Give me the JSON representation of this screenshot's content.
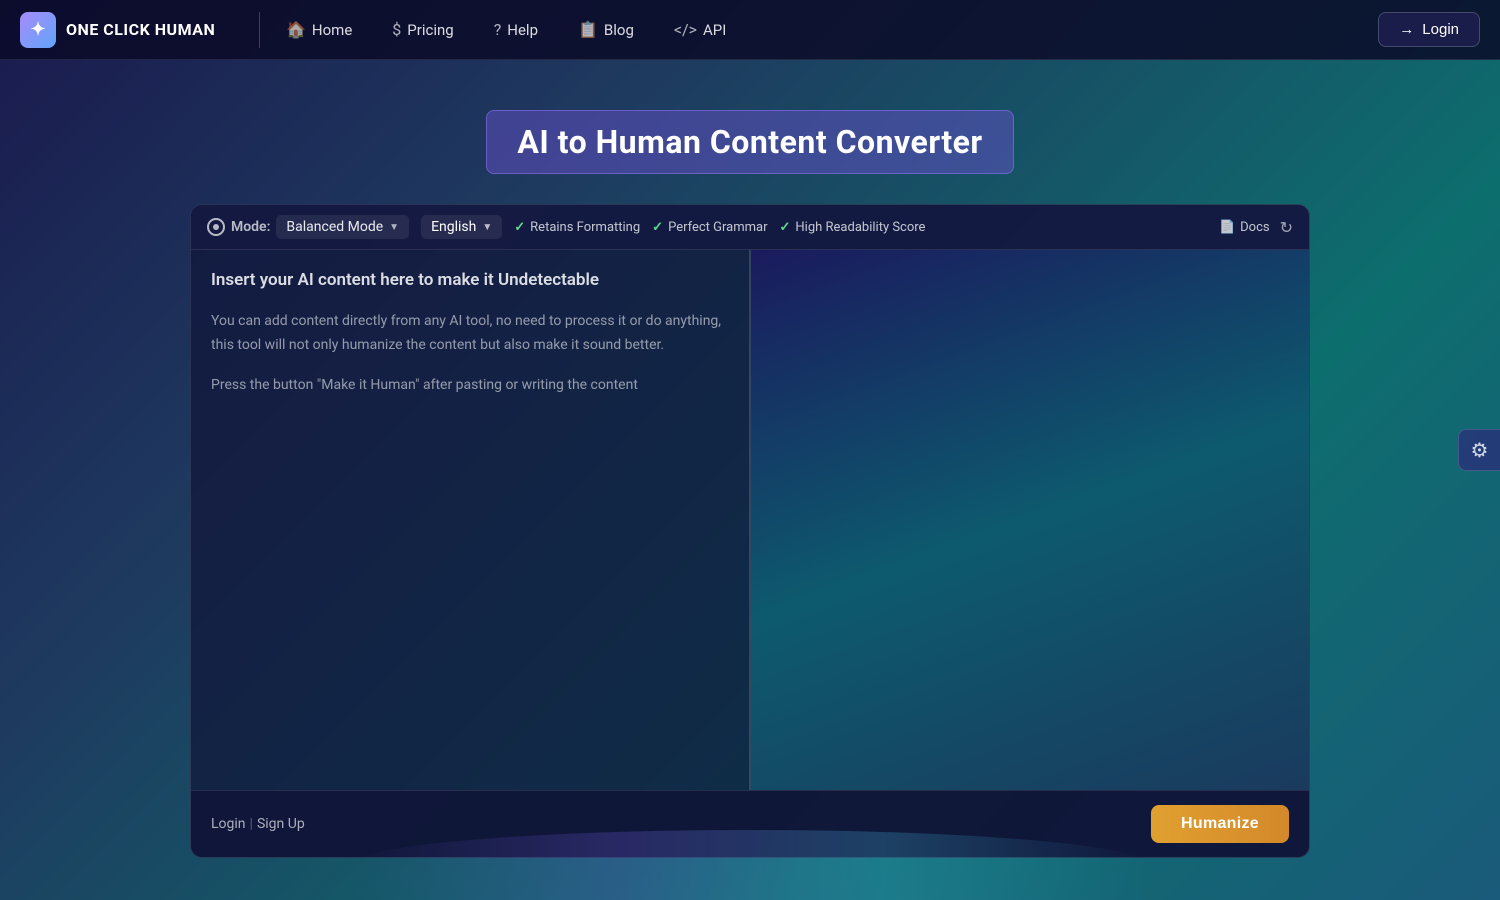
{
  "nav": {
    "logo_text": "ONE CLICK HUMAN",
    "links": [
      {
        "id": "home",
        "label": "Home",
        "icon": "🏠"
      },
      {
        "id": "pricing",
        "label": "Pricing",
        "icon": "$"
      },
      {
        "id": "help",
        "label": "Help",
        "icon": "?"
      },
      {
        "id": "blog",
        "label": "Blog",
        "icon": "📋"
      },
      {
        "id": "api",
        "label": "API",
        "icon": "</>"
      }
    ],
    "login_label": "Login"
  },
  "header": {
    "title": "AI to Human Content Converter"
  },
  "toolbar": {
    "mode_label": "Mode:",
    "mode_value": "Balanced Mode",
    "language_value": "English",
    "badges": [
      {
        "id": "formatting",
        "label": "Retains Formatting"
      },
      {
        "id": "grammar",
        "label": "Perfect Grammar"
      },
      {
        "id": "readability",
        "label": "High Readability Score"
      }
    ],
    "docs_label": "Docs",
    "refresh_icon": "↻"
  },
  "editor": {
    "input_placeholder_title": "Insert your AI content here to make it Undetectable",
    "input_placeholder_lines": [
      "You can add content directly from any AI tool, no need to process it or do anything, this tool will not only humanize the content but also make it sound better.",
      "Press the button \"Make it Human\" after pasting or writing the content"
    ]
  },
  "footer": {
    "login_label": "Login",
    "separator": "|",
    "signup_label": "Sign Up",
    "humanize_label": "Humanize"
  },
  "settings": {
    "icon": "⚙"
  }
}
